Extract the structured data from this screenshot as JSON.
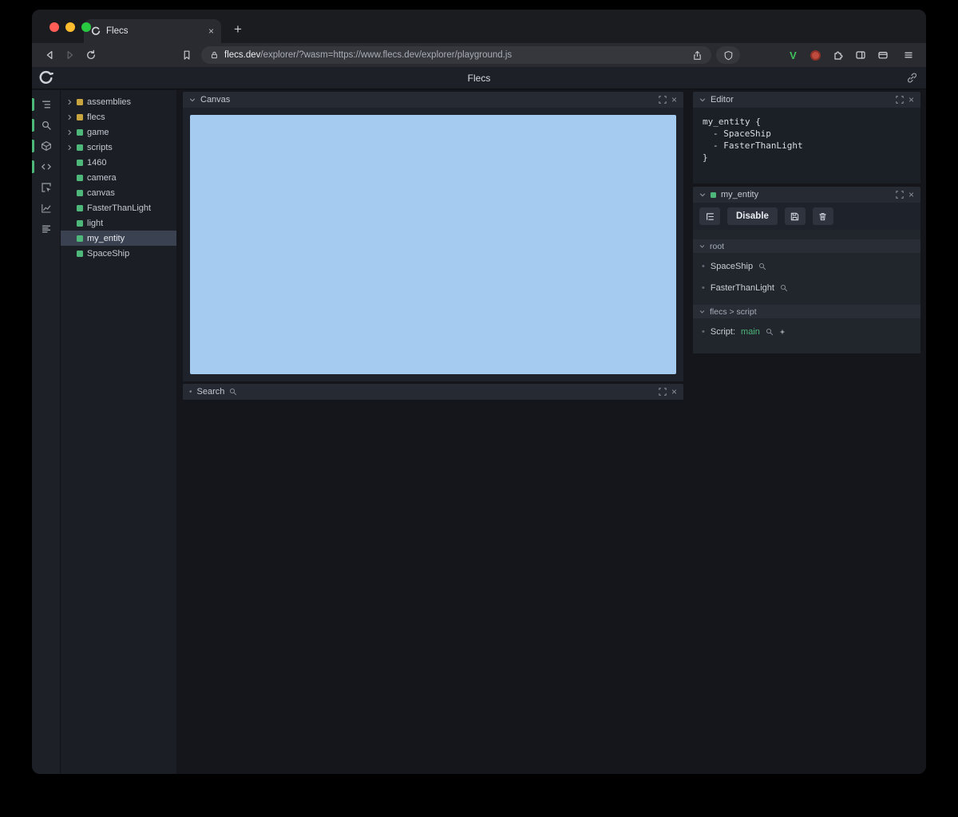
{
  "browser": {
    "tab_title": "Flecs",
    "new_tab_label": "+",
    "url_host": "flecs.dev",
    "url_rest": "/explorer/?wasm=https://www.flecs.dev/explorer/playground.js"
  },
  "app": {
    "header_title": "Flecs",
    "sidebar_icons": [
      "tree",
      "search",
      "cube",
      "code",
      "inspect",
      "chart",
      "list"
    ],
    "tree": {
      "items": [
        {
          "label": "assemblies",
          "expandable": true,
          "color": "yellow"
        },
        {
          "label": "flecs",
          "expandable": true,
          "color": "yellow"
        },
        {
          "label": "game",
          "expandable": true,
          "color": "green"
        },
        {
          "label": "scripts",
          "expandable": true,
          "color": "green"
        },
        {
          "label": "1460",
          "expandable": false,
          "color": "green"
        },
        {
          "label": "camera",
          "expandable": false,
          "color": "green"
        },
        {
          "label": "canvas",
          "expandable": false,
          "color": "green"
        },
        {
          "label": "FasterThanLight",
          "expandable": false,
          "color": "green"
        },
        {
          "label": "light",
          "expandable": false,
          "color": "green"
        },
        {
          "label": "my_entity",
          "expandable": false,
          "color": "green",
          "selected": true
        },
        {
          "label": "SpaceShip",
          "expandable": false,
          "color": "green"
        }
      ]
    },
    "canvas_panel": {
      "title": "Canvas"
    },
    "search_panel": {
      "title": "Search"
    },
    "editor_panel": {
      "title": "Editor",
      "code": [
        "my_entity {",
        "- SpaceShip",
        "- FasterThanLight",
        "}"
      ]
    },
    "inspector_panel": {
      "title": "my_entity",
      "disable_button": "Disable",
      "sections": [
        {
          "title": "root",
          "rows": [
            {
              "label": "SpaceShip"
            },
            {
              "label": "FasterThanLight"
            }
          ]
        },
        {
          "title": "flecs > script",
          "rows": [
            {
              "prefix": "Script:",
              "value": "main"
            }
          ]
        }
      ]
    }
  },
  "colors": {
    "green": "#4db87a",
    "yellow": "#c9a53f",
    "canvas_blue": "#a5cbf1",
    "selected_row": "#3a4150"
  }
}
